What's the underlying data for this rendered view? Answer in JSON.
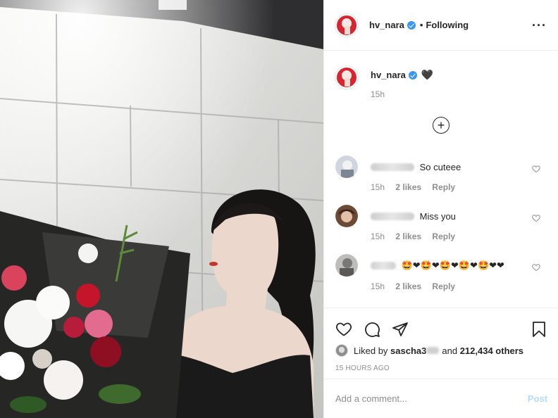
{
  "post": {
    "username": "hv_nara",
    "follow_state": "Following",
    "more_icon": "more-options-icon",
    "caption_emoji": "🖤",
    "caption_time": "15h",
    "load_more_icon": "plus-circle-icon"
  },
  "comments": [
    {
      "text": "So cuteee",
      "time": "15h",
      "likes": "2 likes",
      "reply": "Reply"
    },
    {
      "text": "Miss you",
      "time": "15h",
      "likes": "2 likes",
      "reply": "Reply"
    },
    {
      "text": "🤩❤🤩❤🤩❤🤩❤🤩❤❤",
      "time": "15h",
      "likes": "2 likes",
      "reply": "Reply"
    }
  ],
  "actions": {
    "icons": [
      "heart-icon",
      "comment-icon",
      "share-icon",
      "bookmark-icon"
    ]
  },
  "likes": {
    "prefix": "Liked by",
    "user": "sascha3",
    "joiner": "and",
    "count": "212,434 others"
  },
  "timestamp": "15 HOURS AGO",
  "add_comment": {
    "placeholder": "Add a comment...",
    "post_label": "Post"
  },
  "colors": {
    "verified": "#3897f0",
    "post_disabled": "#b3dbff",
    "secondary_text": "#8e8e8e"
  }
}
